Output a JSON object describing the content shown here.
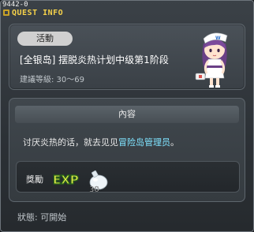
{
  "quest_id": "9442-0",
  "window_title": "QUEST INFO",
  "quest": {
    "tag": "活動",
    "name": "[全银岛] 摆脱炎热计划中级第1阶段",
    "level": "建議等級: 30～69"
  },
  "content": {
    "header": "內容",
    "desc_prefix": "讨厌炎热的话，就去见见",
    "desc_highlight": "冒险岛管理员",
    "desc_suffix": "。"
  },
  "reward": {
    "label": "獎勵",
    "exp_text": "EXP",
    "amount": "30"
  },
  "status": "狀態:  可開始",
  "colors": {
    "title": "#f6d24a",
    "highlight": "#7fe3ff"
  }
}
